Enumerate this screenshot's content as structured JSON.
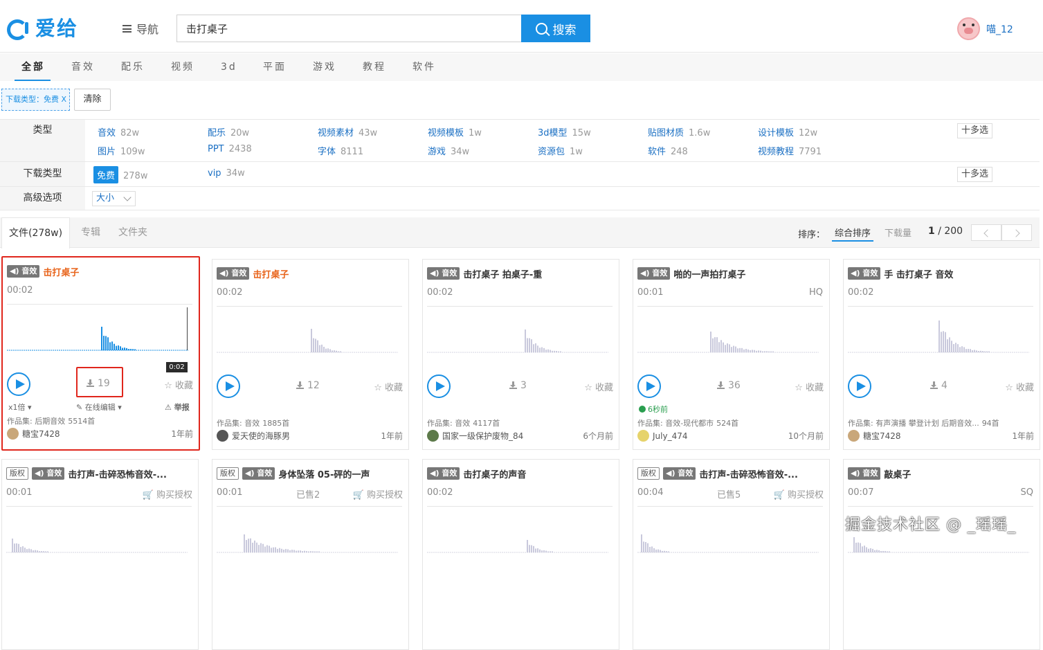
{
  "header": {
    "logo_text": "爱给",
    "nav_label": "导航",
    "search_value": "击打桌子",
    "search_button": "搜索",
    "username": "喵_12"
  },
  "categories": [
    "全部",
    "音效",
    "配乐",
    "视频",
    "3d",
    "平面",
    "游戏",
    "教程",
    "软件"
  ],
  "active_filter": {
    "label": "下载类型：免费 X",
    "clear": "清除"
  },
  "filters": {
    "type": {
      "label": "类型",
      "items": [
        {
          "name": "音效",
          "count": "82w"
        },
        {
          "name": "配乐",
          "count": "20w"
        },
        {
          "name": "视频素材",
          "count": "43w"
        },
        {
          "name": "视频模板",
          "count": "1w"
        },
        {
          "name": "3d模型",
          "count": "15w"
        },
        {
          "name": "贴图材质",
          "count": "1.6w"
        },
        {
          "name": "设计模板",
          "count": "12w"
        },
        {
          "name": "图片",
          "count": "109w"
        },
        {
          "name": "PPT",
          "count": "2438"
        },
        {
          "name": "字体",
          "count": "8111"
        },
        {
          "name": "游戏",
          "count": "34w"
        },
        {
          "name": "资源包",
          "count": "1w"
        },
        {
          "name": "软件",
          "count": "248"
        },
        {
          "name": "视频教程",
          "count": "7791"
        }
      ],
      "multi": "十多选"
    },
    "download": {
      "label": "下载类型",
      "items": [
        {
          "name": "免费",
          "count": "278w"
        },
        {
          "name": "vip",
          "count": "34w"
        }
      ],
      "multi": "十多选"
    },
    "advanced": {
      "label": "高级选项",
      "dropdown": "大小"
    }
  },
  "results": {
    "tabs": [
      "文件(278w)",
      "专辑",
      "文件夹"
    ],
    "sort_label": "排序：",
    "sort_options": [
      "综合排序",
      "下载量"
    ],
    "page": "1",
    "pages": "/ 200"
  },
  "cards_row1": [
    {
      "tag": "音效",
      "title": "击打桌子",
      "duration": "00:02",
      "downloads": "19",
      "fav": "☆ 收藏",
      "speed": "x1倍",
      "edit": "在线编辑",
      "report": "举报",
      "collection": "作品集:  后期音效",
      "coll_count": "5514首",
      "author": "糖宝7428",
      "time": "1年前",
      "time_pill": "0:02"
    },
    {
      "tag": "音效",
      "title": "击打桌子",
      "duration": "00:02",
      "downloads": "12",
      "fav": "☆ 收藏",
      "collection": "作品集:  音效",
      "coll_count": "1885首",
      "author": "爱天使的海豚男",
      "time": "1年前"
    },
    {
      "tag": "音效",
      "title": "击打桌子 拍桌子-重",
      "duration": "00:02",
      "downloads": "3",
      "fav": "☆ 收藏",
      "collection": "作品集:  音效",
      "coll_count": "4117首",
      "author": "国家一级保护废物_84",
      "time": "6个月前"
    },
    {
      "tag": "音效",
      "title": "啪的一声拍打桌子",
      "duration": "00:01",
      "quality": "HQ",
      "downloads": "36",
      "fav": "☆ 收藏",
      "new_time": "6秒前",
      "collection": "作品集:  音效-现代都市",
      "coll_count": "524首",
      "author": "July_474",
      "time": "10个月前"
    },
    {
      "tag": "音效",
      "title": "手 击打桌子 音效",
      "duration": "00:02",
      "downloads": "4",
      "fav": "☆ 收藏",
      "collection": "作品集:  有声演播 攀登计划 后期音效...",
      "coll_count": "94首",
      "author": "糖宝7428",
      "time": "1年前"
    }
  ],
  "cards_row2": [
    {
      "copyright": "版权",
      "tag": "音效",
      "title": "击打声-击碎恐怖音效-...",
      "duration": "00:01",
      "buy": "购买授权"
    },
    {
      "copyright": "版权",
      "tag": "音效",
      "title": "身体坠落 05-砰的一声",
      "duration": "00:01",
      "sold": "已售2",
      "buy": "购买授权"
    },
    {
      "tag": "音效",
      "title": "击打桌子的声音",
      "duration": "00:02"
    },
    {
      "copyright": "版权",
      "tag": "音效",
      "title": "击打声-击碎恐怖音效-...",
      "duration": "00:04",
      "sold": "已售5",
      "buy": "购买授权"
    },
    {
      "tag": "音效",
      "title": "敲桌子",
      "duration": "00:07",
      "quality": "SQ"
    }
  ],
  "watermark": "掘金技术社区 @ _瑶瑶_",
  "colors": {
    "accent": "#1a8fe3",
    "highlight": "#e0261c",
    "title_em": "#e8641b"
  }
}
